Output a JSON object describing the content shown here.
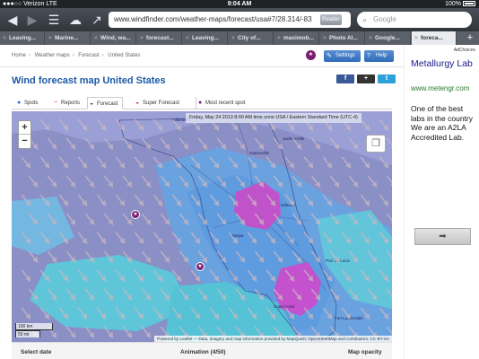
{
  "status_bar": {
    "carrier": "Verizon",
    "network": "LTE",
    "time": "9:04 AM",
    "battery": "100%"
  },
  "browser": {
    "url": "www.windfinder.com/weather-maps/forecast/usa#7/28.314/-83",
    "reader_label": "Reader",
    "search_placeholder": "Google",
    "tabs": [
      {
        "label": "Leaving..."
      },
      {
        "label": "Marine..."
      },
      {
        "label": "Wind, wa..."
      },
      {
        "label": "forecast..."
      },
      {
        "label": "Leaving..."
      },
      {
        "label": "City of..."
      },
      {
        "label": "maximob..."
      },
      {
        "label": "Photo Al..."
      },
      {
        "label": "Google..."
      },
      {
        "label": "foreca..."
      }
    ]
  },
  "page": {
    "breadcrumb": [
      "Home",
      "Weather maps",
      "Forecast",
      "United States"
    ],
    "settings_label": "Settings",
    "help_label": "Help",
    "title": "Wind forecast map United States",
    "social": [
      "f",
      "+",
      "t"
    ],
    "map_tabs": [
      {
        "label": "Spots"
      },
      {
        "label": "Reports"
      },
      {
        "label": "Forecast"
      },
      {
        "label": "Super Forecast"
      },
      {
        "label": "Most recent spot"
      }
    ],
    "map": {
      "timestamp": "Friday, May 24 2013 8:00 AM time zone USA / Eastern Standard Time (UTC-4)",
      "zoom_in": "+",
      "zoom_out": "−",
      "scale_km": "100 km",
      "scale_mi": "50 mi",
      "attribution": "Powered by Leaflet — Data, imagery and map information provided by MapQuest, OpenStreetMap and contributors, CC-BY-SA",
      "place_labels": [
        "Tallahassee",
        "Jacksonville",
        "Gainesville",
        "Orlando",
        "Tampa",
        "Port St. Lucie",
        "Fort Lauderdale",
        "Cape Coral"
      ]
    },
    "bottom": {
      "select_date": "Select date",
      "animation": "Animation (4/50)",
      "map_opacity": "Map opacity"
    }
  },
  "ad": {
    "adchoices": "AdChoices",
    "title": "Metallurgy Lab",
    "url": "www.metengr.com",
    "body": "One of the best labs in the country We are an A2LA Accredited Lab.",
    "button": "➡"
  }
}
